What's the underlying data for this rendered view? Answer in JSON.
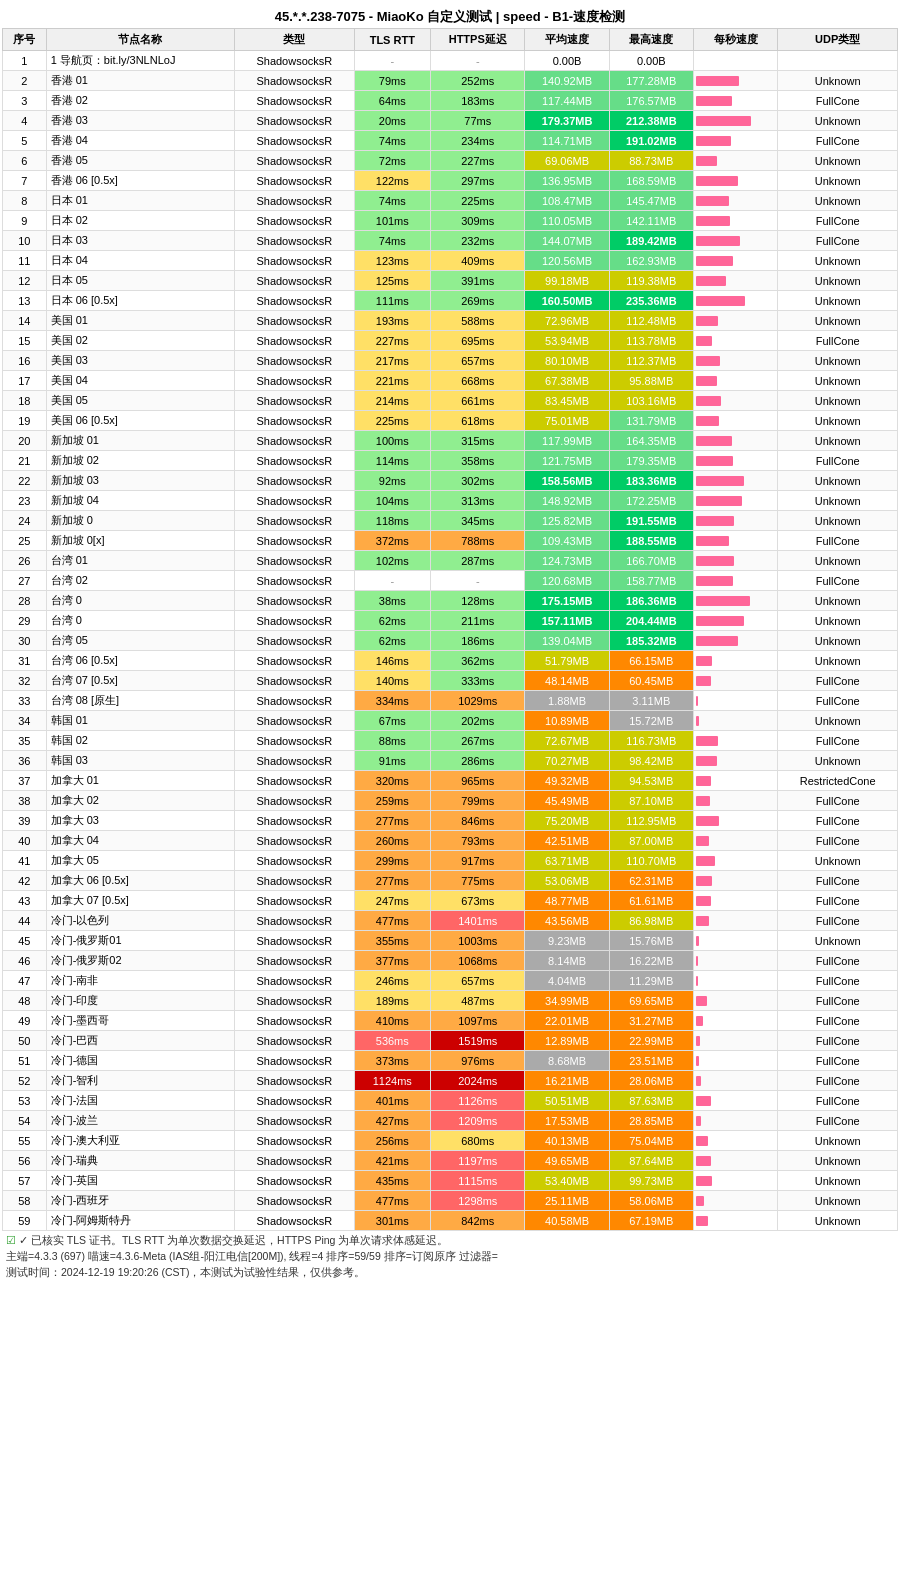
{
  "title": "45.*.*.238-7075 - MiaoKo 自定义测试 | speed - B1-速度检测",
  "columns": [
    "序号",
    "节点名称",
    "类型",
    "TLS RTT",
    "HTTPS延迟",
    "平均速度",
    "最高速度",
    "每秒速度",
    "UDP类型"
  ],
  "rows": [
    {
      "id": 1,
      "name": "1 导航页：bit.ly/3NLNLoJ",
      "type": "ShadowsocksR",
      "tls": "-",
      "https": "-",
      "avg": "0.00B",
      "max": "0.00B",
      "udp": ""
    },
    {
      "id": 2,
      "name": "香港 01",
      "type": "ShadowsocksR",
      "tls": "79ms",
      "https": "252ms",
      "avg": "140.92MB",
      "max": "177.28MB",
      "udp": "Unknown"
    },
    {
      "id": 3,
      "name": "香港 02",
      "type": "ShadowsocksR",
      "tls": "64ms",
      "https": "183ms",
      "avg": "117.44MB",
      "max": "176.57MB",
      "udp": "FullCone"
    },
    {
      "id": 4,
      "name": "香港 03",
      "type": "ShadowsocksR",
      "tls": "20ms",
      "https": "77ms",
      "avg": "179.37MB",
      "max": "212.38MB",
      "udp": "Unknown"
    },
    {
      "id": 5,
      "name": "香港 04",
      "type": "ShadowsocksR",
      "tls": "74ms",
      "https": "234ms",
      "avg": "114.71MB",
      "max": "191.02MB",
      "udp": "FullCone"
    },
    {
      "id": 6,
      "name": "香港 05",
      "type": "ShadowsocksR",
      "tls": "72ms",
      "https": "227ms",
      "avg": "69.06MB",
      "max": "88.73MB",
      "udp": "Unknown"
    },
    {
      "id": 7,
      "name": "香港 06 [0.5x]",
      "type": "ShadowsocksR",
      "tls": "122ms",
      "https": "297ms",
      "avg": "136.95MB",
      "max": "168.59MB",
      "udp": "Unknown"
    },
    {
      "id": 8,
      "name": "日本 01",
      "type": "ShadowsocksR",
      "tls": "74ms",
      "https": "225ms",
      "avg": "108.47MB",
      "max": "145.47MB",
      "udp": "Unknown"
    },
    {
      "id": 9,
      "name": "日本 02",
      "type": "ShadowsocksR",
      "tls": "101ms",
      "https": "309ms",
      "avg": "110.05MB",
      "max": "142.11MB",
      "udp": "FullCone"
    },
    {
      "id": 10,
      "name": "日本 03",
      "type": "ShadowsocksR",
      "tls": "74ms",
      "https": "232ms",
      "avg": "144.07MB",
      "max": "189.42MB",
      "udp": "FullCone"
    },
    {
      "id": 11,
      "name": "日本 04",
      "type": "ShadowsocksR",
      "tls": "123ms",
      "https": "409ms",
      "avg": "120.56MB",
      "max": "162.93MB",
      "udp": "Unknown"
    },
    {
      "id": 12,
      "name": "日本 05",
      "type": "ShadowsocksR",
      "tls": "125ms",
      "https": "391ms",
      "avg": "99.18MB",
      "max": "119.38MB",
      "udp": "Unknown"
    },
    {
      "id": 13,
      "name": "日本 06 [0.5x]",
      "type": "ShadowsocksR",
      "tls": "111ms",
      "https": "269ms",
      "avg": "160.50MB",
      "max": "235.36MB",
      "udp": "Unknown"
    },
    {
      "id": 14,
      "name": "美国 01",
      "type": "ShadowsocksR",
      "tls": "193ms",
      "https": "588ms",
      "avg": "72.96MB",
      "max": "112.48MB",
      "udp": "Unknown"
    },
    {
      "id": 15,
      "name": "美国 02",
      "type": "ShadowsocksR",
      "tls": "227ms",
      "https": "695ms",
      "avg": "53.94MB",
      "max": "113.78MB",
      "udp": "FullCone"
    },
    {
      "id": 16,
      "name": "美国 03",
      "type": "ShadowsocksR",
      "tls": "217ms",
      "https": "657ms",
      "avg": "80.10MB",
      "max": "112.37MB",
      "udp": "Unknown"
    },
    {
      "id": 17,
      "name": "美国 04",
      "type": "ShadowsocksR",
      "tls": "221ms",
      "https": "668ms",
      "avg": "67.38MB",
      "max": "95.88MB",
      "udp": "Unknown"
    },
    {
      "id": 18,
      "name": "美国 05",
      "type": "ShadowsocksR",
      "tls": "214ms",
      "https": "661ms",
      "avg": "83.45MB",
      "max": "103.16MB",
      "udp": "Unknown"
    },
    {
      "id": 19,
      "name": "美国 06 [0.5x]",
      "type": "ShadowsocksR",
      "tls": "225ms",
      "https": "618ms",
      "avg": "75.01MB",
      "max": "131.79MB",
      "udp": "Unknown"
    },
    {
      "id": 20,
      "name": "新加坡 01",
      "type": "ShadowsocksR",
      "tls": "100ms",
      "https": "315ms",
      "avg": "117.99MB",
      "max": "164.35MB",
      "udp": "Unknown"
    },
    {
      "id": 21,
      "name": "新加坡 02",
      "type": "ShadowsocksR",
      "tls": "114ms",
      "https": "358ms",
      "avg": "121.75MB",
      "max": "179.35MB",
      "udp": "FullCone"
    },
    {
      "id": 22,
      "name": "新加坡 03",
      "type": "ShadowsocksR",
      "tls": "92ms",
      "https": "302ms",
      "avg": "158.56MB",
      "max": "183.36MB",
      "udp": "Unknown"
    },
    {
      "id": 23,
      "name": "新加坡 04",
      "type": "ShadowsocksR",
      "tls": "104ms",
      "https": "313ms",
      "avg": "148.92MB",
      "max": "172.25MB",
      "udp": "Unknown"
    },
    {
      "id": 24,
      "name": "新加坡 0",
      "type": "ShadowsocksR",
      "tls": "118ms",
      "https": "345ms",
      "avg": "125.82MB",
      "max": "191.55MB",
      "udp": "Unknown"
    },
    {
      "id": 25,
      "name": "新加坡 0[x]",
      "type": "ShadowsocksR",
      "tls": "372ms",
      "https": "788ms",
      "avg": "109.43MB",
      "max": "188.55MB",
      "udp": "FullCone"
    },
    {
      "id": 26,
      "name": "台湾 01",
      "type": "ShadowsocksR",
      "tls": "102ms",
      "https": "287ms",
      "avg": "124.73MB",
      "max": "166.70MB",
      "udp": "Unknown"
    },
    {
      "id": 27,
      "name": "台湾 02",
      "type": "ShadowsocksR",
      "tls": "-",
      "https": "-",
      "avg": "120.68MB",
      "max": "158.77MB",
      "udp": "FullCone"
    },
    {
      "id": 28,
      "name": "台湾 0",
      "type": "ShadowsocksR",
      "tls": "38ms",
      "https": "128ms",
      "avg": "175.15MB",
      "max": "186.36MB",
      "udp": "Unknown"
    },
    {
      "id": 29,
      "name": "台湾 0",
      "type": "ShadowsocksR",
      "tls": "62ms",
      "https": "211ms",
      "avg": "157.11MB",
      "max": "204.44MB",
      "udp": "Unknown"
    },
    {
      "id": 30,
      "name": "台湾 05",
      "type": "ShadowsocksR",
      "tls": "62ms",
      "https": "186ms",
      "avg": "139.04MB",
      "max": "185.32MB",
      "udp": "Unknown"
    },
    {
      "id": 31,
      "name": "台湾 06 [0.5x]",
      "type": "ShadowsocksR",
      "tls": "146ms",
      "https": "362ms",
      "avg": "51.79MB",
      "max": "66.15MB",
      "udp": "Unknown"
    },
    {
      "id": 32,
      "name": "台湾 07 [0.5x]",
      "type": "ShadowsocksR",
      "tls": "140ms",
      "https": "333ms",
      "avg": "48.14MB",
      "max": "60.45MB",
      "udp": "FullCone"
    },
    {
      "id": 33,
      "name": "台湾 08 [原生]",
      "type": "ShadowsocksR",
      "tls": "334ms",
      "https": "1029ms",
      "avg": "1.88MB",
      "max": "3.11MB",
      "udp": "FullCone"
    },
    {
      "id": 34,
      "name": "韩国 01",
      "type": "ShadowsocksR",
      "tls": "67ms",
      "https": "202ms",
      "avg": "10.89MB",
      "max": "15.72MB",
      "udp": "Unknown"
    },
    {
      "id": 35,
      "name": "韩国 02",
      "type": "ShadowsocksR",
      "tls": "88ms",
      "https": "267ms",
      "avg": "72.67MB",
      "max": "116.73MB",
      "udp": "FullCone"
    },
    {
      "id": 36,
      "name": "韩国 03",
      "type": "ShadowsocksR",
      "tls": "91ms",
      "https": "286ms",
      "avg": "70.27MB",
      "max": "98.42MB",
      "udp": "Unknown"
    },
    {
      "id": 37,
      "name": "加拿大 01",
      "type": "ShadowsocksR",
      "tls": "320ms",
      "https": "965ms",
      "avg": "49.32MB",
      "max": "94.53MB",
      "udp": "RestrictedCone"
    },
    {
      "id": 38,
      "name": "加拿大 02",
      "type": "ShadowsocksR",
      "tls": "259ms",
      "https": "799ms",
      "avg": "45.49MB",
      "max": "87.10MB",
      "udp": "FullCone"
    },
    {
      "id": 39,
      "name": "加拿大 03",
      "type": "ShadowsocksR",
      "tls": "277ms",
      "https": "846ms",
      "avg": "75.20MB",
      "max": "112.95MB",
      "udp": "FullCone"
    },
    {
      "id": 40,
      "name": "加拿大 04",
      "type": "ShadowsocksR",
      "tls": "260ms",
      "https": "793ms",
      "avg": "42.51MB",
      "max": "87.00MB",
      "udp": "FullCone"
    },
    {
      "id": 41,
      "name": "加拿大 05",
      "type": "ShadowsocksR",
      "tls": "299ms",
      "https": "917ms",
      "avg": "63.71MB",
      "max": "110.70MB",
      "udp": "Unknown"
    },
    {
      "id": 42,
      "name": "加拿大 06 [0.5x]",
      "type": "ShadowsocksR",
      "tls": "277ms",
      "https": "775ms",
      "avg": "53.06MB",
      "max": "62.31MB",
      "udp": "FullCone"
    },
    {
      "id": 43,
      "name": "加拿大 07 [0.5x]",
      "type": "ShadowsocksR",
      "tls": "247ms",
      "https": "673ms",
      "avg": "48.77MB",
      "max": "61.61MB",
      "udp": "FullCone"
    },
    {
      "id": 44,
      "name": "冷门-以色列",
      "type": "ShadowsocksR",
      "tls": "477ms",
      "https": "1401ms",
      "avg": "43.56MB",
      "max": "86.98MB",
      "udp": "FullCone"
    },
    {
      "id": 45,
      "name": "冷门-俄罗斯01",
      "type": "ShadowsocksR",
      "tls": "355ms",
      "https": "1003ms",
      "avg": "9.23MB",
      "max": "15.76MB",
      "udp": "Unknown"
    },
    {
      "id": 46,
      "name": "冷门-俄罗斯02",
      "type": "ShadowsocksR",
      "tls": "377ms",
      "https": "1068ms",
      "avg": "8.14MB",
      "max": "16.22MB",
      "udp": "FullCone"
    },
    {
      "id": 47,
      "name": "冷门-南非",
      "type": "ShadowsocksR",
      "tls": "246ms",
      "https": "657ms",
      "avg": "4.04MB",
      "max": "11.29MB",
      "udp": "FullCone"
    },
    {
      "id": 48,
      "name": "冷门-印度",
      "type": "ShadowsocksR",
      "tls": "189ms",
      "https": "487ms",
      "avg": "34.99MB",
      "max": "69.65MB",
      "udp": "FullCone"
    },
    {
      "id": 49,
      "name": "冷门-墨西哥",
      "type": "ShadowsocksR",
      "tls": "410ms",
      "https": "1097ms",
      "avg": "22.01MB",
      "max": "31.27MB",
      "udp": "FullCone"
    },
    {
      "id": 50,
      "name": "冷门-巴西",
      "type": "ShadowsocksR",
      "tls": "536ms",
      "https": "1519ms",
      "avg": "12.89MB",
      "max": "22.99MB",
      "udp": "FullCone"
    },
    {
      "id": 51,
      "name": "冷门-德国",
      "type": "ShadowsocksR",
      "tls": "373ms",
      "https": "976ms",
      "avg": "8.68MB",
      "max": "23.51MB",
      "udp": "FullCone"
    },
    {
      "id": 52,
      "name": "冷门-智利",
      "type": "ShadowsocksR",
      "tls": "1124ms",
      "https": "2024ms",
      "avg": "16.21MB",
      "max": "28.06MB",
      "udp": "FullCone"
    },
    {
      "id": 53,
      "name": "冷门-法国",
      "type": "ShadowsocksR",
      "tls": "401ms",
      "https": "1126ms",
      "avg": "50.51MB",
      "max": "87.63MB",
      "udp": "FullCone"
    },
    {
      "id": 54,
      "name": "冷门-波兰",
      "type": "ShadowsocksR",
      "tls": "427ms",
      "https": "1209ms",
      "avg": "17.53MB",
      "max": "28.85MB",
      "udp": "FullCone"
    },
    {
      "id": 55,
      "name": "冷门-澳大利亚",
      "type": "ShadowsocksR",
      "tls": "256ms",
      "https": "680ms",
      "avg": "40.13MB",
      "max": "75.04MB",
      "udp": "Unknown"
    },
    {
      "id": 56,
      "name": "冷门-瑞典",
      "type": "ShadowsocksR",
      "tls": "421ms",
      "https": "1197ms",
      "avg": "49.65MB",
      "max": "87.64MB",
      "udp": "Unknown"
    },
    {
      "id": 57,
      "name": "冷门-英国",
      "type": "ShadowsocksR",
      "tls": "435ms",
      "https": "1115ms",
      "avg": "53.40MB",
      "max": "99.73MB",
      "udp": "Unknown"
    },
    {
      "id": 58,
      "name": "冷门-西班牙",
      "type": "ShadowsocksR",
      "tls": "477ms",
      "https": "1298ms",
      "avg": "25.11MB",
      "max": "58.06MB",
      "udp": "Unknown"
    },
    {
      "id": 59,
      "name": "冷门-阿姆斯特丹",
      "type": "ShadowsocksR",
      "tls": "301ms",
      "https": "842ms",
      "avg": "40.58MB",
      "max": "67.19MB",
      "udp": "Unknown"
    }
  ],
  "footer": {
    "check": "✓ 已核实 TLS 证书。TLS RTT 为单次数据交换延迟，HTTPS Ping 为单次请求体感延迟。",
    "info": "主端=4.3.3 (697) 喵速=4.3.6-Meta (IAS组-阳江电信[200M]), 线程=4 排序=59/59 排序=订阅原序 过滤器=",
    "time": "测试时间：2024-12-19 19:20:26 (CST)，本测试为试验性结果，仅供参考。"
  }
}
